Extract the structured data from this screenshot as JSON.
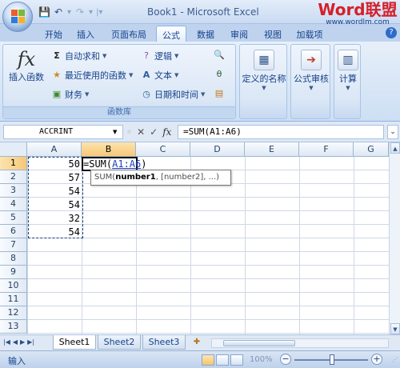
{
  "window": {
    "title": "Book1 - Microsoft Excel"
  },
  "watermark": {
    "main": "Word联盟",
    "url": "www.wordlm.com"
  },
  "quick_access": {
    "icons": [
      "save-icon",
      "undo-icon",
      "redo-icon",
      "customize-icon"
    ]
  },
  "tabs": [
    "开始",
    "插入",
    "页面布局",
    "公式",
    "数据",
    "审阅",
    "视图",
    "加载项"
  ],
  "active_tab": "公式",
  "ribbon": {
    "function_library": {
      "label": "函数库",
      "insert_function": "插入函数",
      "autosum": "自动求和",
      "recently_used": "最近使用的函数",
      "financial": "财务",
      "logical": "逻辑",
      "text": "文本",
      "date_time": "日期和时间"
    },
    "defined_names": "定义的名称",
    "formula_auditing": "公式审核",
    "calculation": "计算"
  },
  "formula_bar": {
    "name_box": "ACCRINT",
    "formula": "=SUM(A1:A6)"
  },
  "columns": [
    "A",
    "B",
    "C",
    "D",
    "E",
    "F",
    "G"
  ],
  "rows": [
    "1",
    "2",
    "3",
    "4",
    "5",
    "6",
    "7",
    "8",
    "9",
    "10",
    "11",
    "12",
    "13"
  ],
  "cells": {
    "A1": "50",
    "A2": "57",
    "A3": "54",
    "A4": "54",
    "A5": "32",
    "A6": "54",
    "B1_prefix": "=SUM(",
    "B1_ref": "A1:A6",
    "B1_suffix": ")"
  },
  "tooltip": {
    "func": "SUM(",
    "arg1": "number1",
    "rest": ", [number2], ...)"
  },
  "sheets": [
    "Sheet1",
    "Sheet2",
    "Sheet3"
  ],
  "active_sheet": "Sheet1",
  "status": {
    "mode": "输入",
    "zoom": "100%"
  },
  "colors": {
    "ribbon": "#dbe7f6",
    "accent": "#15428b",
    "selected_header": "#f8c779",
    "ref_blue": "#1f3fbf"
  }
}
